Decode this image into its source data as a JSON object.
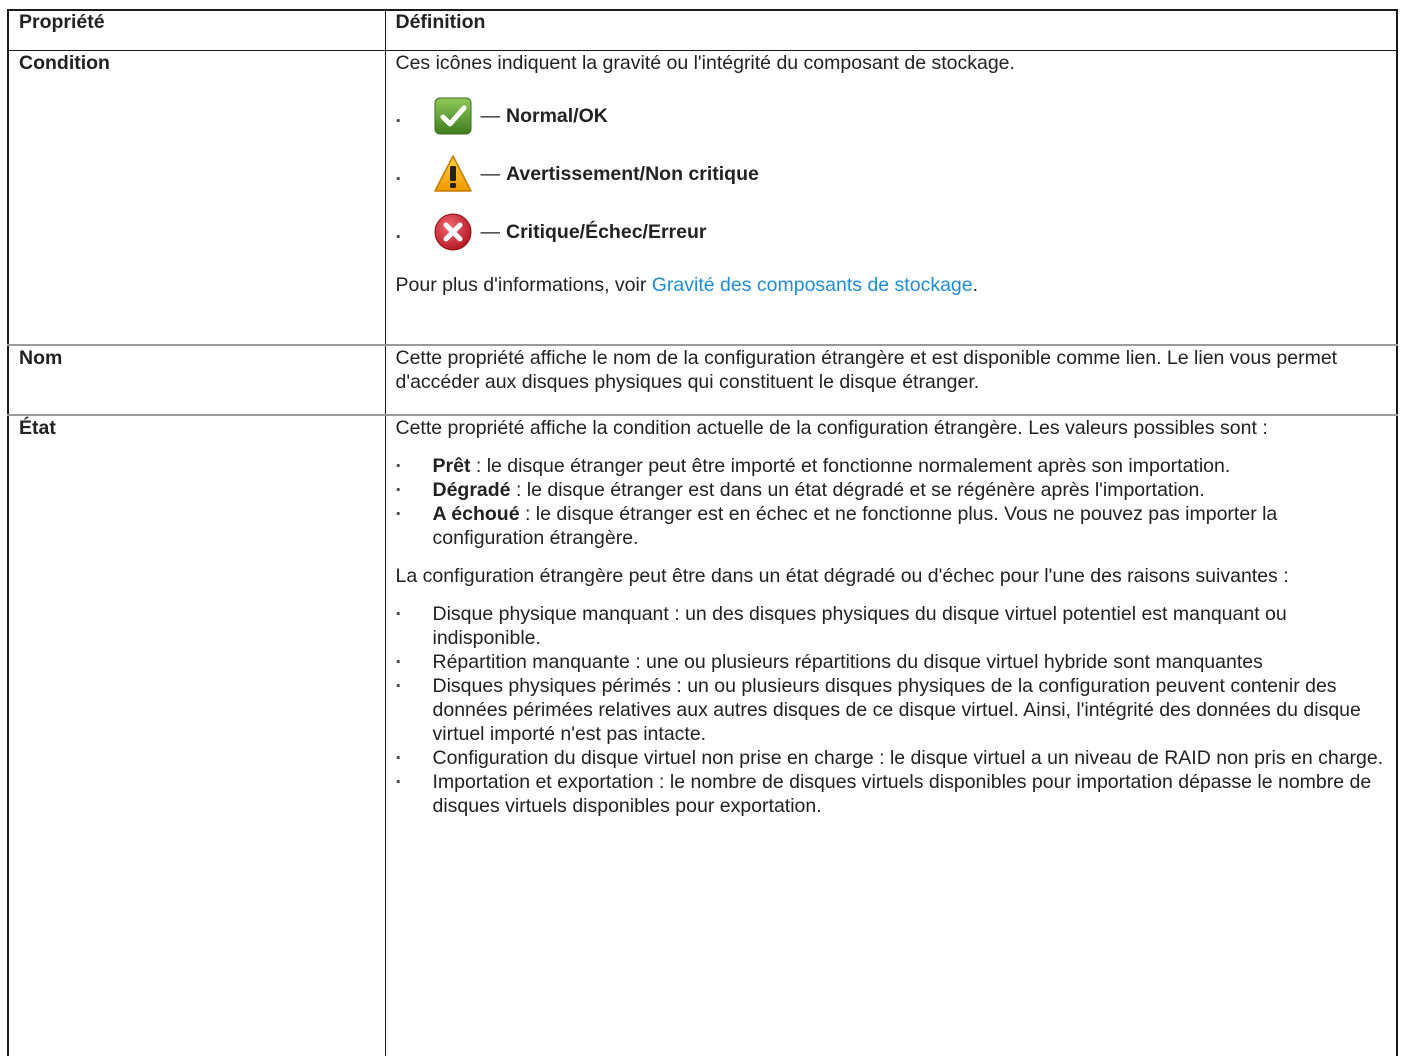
{
  "table": {
    "header": {
      "property": "Propriété",
      "definition": "Définition"
    },
    "condition": {
      "name": "Condition",
      "intro": "Ces icônes indiquent la gravité ou l'intégrité du composant de stockage.",
      "severities": [
        {
          "icon": "check-icon",
          "dash": "—",
          "label": "Normal/OK",
          "color": "#5a9b2e"
        },
        {
          "icon": "warning-icon",
          "dash": "—",
          "label": "Avertissement/Non critique",
          "color": "#f0a800"
        },
        {
          "icon": "critical-icon",
          "dash": "—",
          "label": "Critique/Échec/Erreur",
          "color": "#cc2a36"
        }
      ],
      "more_prefix": "Pour plus d'informations, voir ",
      "more_link": "Gravité des composants de stockage",
      "more_suffix": "."
    },
    "nom": {
      "name": "Nom",
      "definition": "Cette propriété affiche le nom de la configuration étrangère et est disponible comme lien. Le lien vous permet d'accéder aux disques physiques qui constituent le disque étranger."
    },
    "etat": {
      "name": "État",
      "intro": "Cette propriété affiche la condition actuelle de la configuration étrangère. Les valeurs possibles sont :",
      "states": [
        {
          "term": "Prêt",
          "text": " : le disque étranger peut être importé et fonctionne normalement après son importation."
        },
        {
          "term": "Dégradé",
          "text": " : le disque étranger est dans un état dégradé et se régénère après l'importation."
        },
        {
          "term": "A échoué",
          "text": " : le disque étranger est en échec et ne fonctionne plus. Vous ne pouvez pas importer la configuration étrangère."
        }
      ],
      "reasons_intro": "La configuration étrangère peut être dans un état dégradé ou d'échec pour l'une des raisons suivantes :",
      "reasons": [
        "Disque physique manquant : un des disques physiques du disque virtuel potentiel est manquant ou indisponible.",
        "Répartition manquante : une ou plusieurs répartitions du disque virtuel hybride sont manquantes",
        "Disques physiques périmés : un ou plusieurs disques physiques de la configuration peuvent contenir des données périmées relatives aux autres disques de ce disque virtuel. Ainsi, l'intégrité des données du disque virtuel importé n'est pas intacte.",
        "Configuration du disque virtuel non prise en charge : le disque virtuel a un niveau de RAID non pris en charge.",
        "Importation et exportation : le nombre de disques virtuels disponibles pour importation dépasse le nombre de disques virtuels disponibles pour exportation."
      ]
    }
  }
}
